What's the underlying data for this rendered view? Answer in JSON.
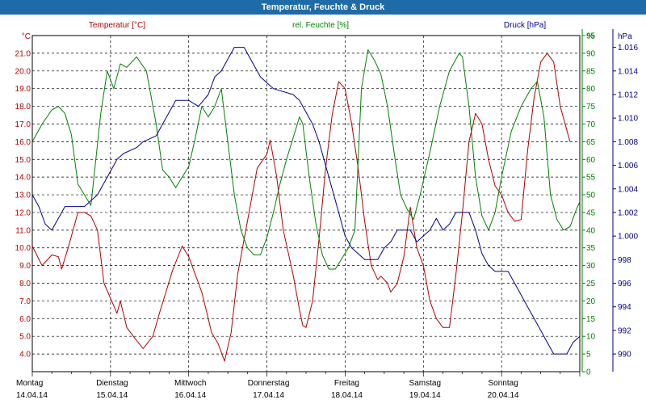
{
  "window": {
    "title": "Temperatur, Feuchte & Druck"
  },
  "colors": {
    "titlebar": "#1f6ba8",
    "temperature": "#b00000",
    "humidity": "#008000",
    "pressure": "#00008b",
    "grid": "#000000"
  },
  "chart_data": {
    "type": "line",
    "title": "Temperatur, Feuchte & Druck",
    "grid": true,
    "x_range": [
      "2014-04-14T00:00",
      "2014-04-21T00:00"
    ],
    "x_ticks": [
      {
        "day": "Montag",
        "date": "14.04.14"
      },
      {
        "day": "Dienstag",
        "date": "15.04.14"
      },
      {
        "day": "Mittwoch",
        "date": "16.04.14"
      },
      {
        "day": "Donnerstag",
        "date": "17.04.14"
      },
      {
        "day": "Freitag",
        "date": "18.04.14"
      },
      {
        "day": "Samstag",
        "date": "19.04.14"
      },
      {
        "day": "Sonntag",
        "date": "20.04.14"
      }
    ],
    "axes": {
      "temperature": {
        "label": "Temperatur [°C]",
        "unit": "°C",
        "ylim": [
          3.0,
          22.0
        ],
        "ticks": [
          "4.0",
          "5.0",
          "6.0",
          "7.0",
          "8.0",
          "9.0",
          "10.0",
          "11.0",
          "12.0",
          "13.0",
          "14.0",
          "15.0",
          "16.0",
          "17.0",
          "18.0",
          "19.0",
          "20.0",
          "21.0"
        ]
      },
      "humidity": {
        "label": "rel. Feuchte [%]",
        "unit": "%",
        "ylim": [
          0,
          95
        ],
        "ticks": [
          "0",
          "5",
          "10",
          "15",
          "20",
          "25",
          "30",
          "35",
          "40",
          "45",
          "50",
          "55",
          "60",
          "65",
          "70",
          "75",
          "80",
          "85",
          "90",
          "95"
        ]
      },
      "pressure": {
        "label": "Druck [hPa]",
        "unit": "hPa",
        "ylim": [
          988.5,
          1017.0
        ],
        "ticks": [
          "990",
          "992",
          "994",
          "996",
          "998",
          "1.000",
          "1.002",
          "1.004",
          "1.006",
          "1.008",
          "1.010",
          "1.012",
          "1.014",
          "1.016"
        ]
      }
    },
    "series": [
      {
        "name": "Temperatur [°C]",
        "axis": "temperature",
        "points": [
          [
            "2014-04-14T00:00",
            10.1
          ],
          [
            "2014-04-14T03:00",
            9.0
          ],
          [
            "2014-04-14T06:00",
            9.6
          ],
          [
            "2014-04-14T08:00",
            9.5
          ],
          [
            "2014-04-14T09:00",
            8.8
          ],
          [
            "2014-04-14T11:00",
            10.0
          ],
          [
            "2014-04-14T14:00",
            12.0
          ],
          [
            "2014-04-14T16:00",
            12.0
          ],
          [
            "2014-04-14T18:00",
            11.8
          ],
          [
            "2014-04-14T20:00",
            11.0
          ],
          [
            "2014-04-14T22:00",
            8.0
          ],
          [
            "2014-04-15T02:00",
            6.3
          ],
          [
            "2014-04-15T03:00",
            7.0
          ],
          [
            "2014-04-15T05:00",
            5.5
          ],
          [
            "2014-04-15T07:00",
            5.0
          ],
          [
            "2014-04-15T10:00",
            4.3
          ],
          [
            "2014-04-15T13:00",
            5.0
          ],
          [
            "2014-04-15T15:00",
            6.3
          ],
          [
            "2014-04-15T17:00",
            7.5
          ],
          [
            "2014-04-15T19:00",
            8.7
          ],
          [
            "2014-04-15T22:00",
            10.1
          ],
          [
            "2014-04-16T00:00",
            9.5
          ],
          [
            "2014-04-16T02:00",
            8.5
          ],
          [
            "2014-04-16T04:00",
            7.5
          ],
          [
            "2014-04-16T06:00",
            6.0
          ],
          [
            "2014-04-16T07:00",
            5.2
          ],
          [
            "2014-04-16T09:00",
            4.6
          ],
          [
            "2014-04-16T11:00",
            3.6
          ],
          [
            "2014-04-16T13:00",
            5.2
          ],
          [
            "2014-04-16T15:00",
            8.5
          ],
          [
            "2014-04-16T18:00",
            11.5
          ],
          [
            "2014-04-16T21:00",
            14.5
          ],
          [
            "2014-04-17T00:00",
            15.3
          ],
          [
            "2014-04-17T01:00",
            16.1
          ],
          [
            "2014-04-17T03:00",
            14.0
          ],
          [
            "2014-04-17T05:00",
            11.0
          ],
          [
            "2014-04-17T08:00",
            8.5
          ],
          [
            "2014-04-17T10:00",
            6.5
          ],
          [
            "2014-04-17T11:00",
            5.6
          ],
          [
            "2014-04-17T12:00",
            5.5
          ],
          [
            "2014-04-17T14:00",
            7.0
          ],
          [
            "2014-04-17T16:00",
            10.5
          ],
          [
            "2014-04-17T18:00",
            14.5
          ],
          [
            "2014-04-17T20:00",
            17.5
          ],
          [
            "2014-04-17T22:00",
            19.4
          ],
          [
            "2014-04-18T00:00",
            19.0
          ],
          [
            "2014-04-18T02:00",
            17.0
          ],
          [
            "2014-04-18T04:00",
            14.5
          ],
          [
            "2014-04-18T06:00",
            11.5
          ],
          [
            "2014-04-18T08:00",
            9.0
          ],
          [
            "2014-04-18T10:00",
            8.2
          ],
          [
            "2014-04-18T11:00",
            8.4
          ],
          [
            "2014-04-18T13:00",
            8.0
          ],
          [
            "2014-04-18T14:00",
            7.5
          ],
          [
            "2014-04-18T16:00",
            8.0
          ],
          [
            "2014-04-18T18:00",
            9.5
          ],
          [
            "2014-04-18T20:00",
            12.3
          ],
          [
            "2014-04-18T22:00",
            10.0
          ],
          [
            "2014-04-19T00:00",
            9.0
          ],
          [
            "2014-04-19T02:00",
            7.0
          ],
          [
            "2014-04-19T04:00",
            6.0
          ],
          [
            "2014-04-19T06:00",
            5.5
          ],
          [
            "2014-04-19T08:00",
            5.5
          ],
          [
            "2014-04-19T10:00",
            8.5
          ],
          [
            "2014-04-19T12:00",
            12.0
          ],
          [
            "2014-04-19T14:00",
            16.0
          ],
          [
            "2014-04-19T16:00",
            17.6
          ],
          [
            "2014-04-19T18:00",
            17.0
          ],
          [
            "2014-04-19T20:00",
            15.0
          ],
          [
            "2014-04-19T22:00",
            13.5
          ],
          [
            "2014-04-20T00:00",
            13.0
          ],
          [
            "2014-04-20T02:00",
            12.0
          ],
          [
            "2014-04-20T04:00",
            11.5
          ],
          [
            "2014-04-20T06:00",
            11.6
          ],
          [
            "2014-04-20T08:00",
            15.5
          ],
          [
            "2014-04-20T10:00",
            18.5
          ],
          [
            "2014-04-20T12:00",
            20.5
          ],
          [
            "2014-04-20T14:00",
            21.0
          ],
          [
            "2014-04-20T16:00",
            20.5
          ],
          [
            "2014-04-20T18:00",
            18.0
          ],
          [
            "2014-04-20T21:00",
            16.0
          ]
        ]
      },
      {
        "name": "rel. Feuchte [%]",
        "axis": "humidity",
        "points": [
          [
            "2014-04-14T00:00",
            65
          ],
          [
            "2014-04-14T03:00",
            70
          ],
          [
            "2014-04-14T06:00",
            74
          ],
          [
            "2014-04-14T08:00",
            75
          ],
          [
            "2014-04-14T10:00",
            73
          ],
          [
            "2014-04-14T12:00",
            67
          ],
          [
            "2014-04-14T14:00",
            53
          ],
          [
            "2014-04-14T16:00",
            50
          ],
          [
            "2014-04-14T18:00",
            47
          ],
          [
            "2014-04-14T21:00",
            73
          ],
          [
            "2014-04-14T23:00",
            85
          ],
          [
            "2014-04-15T01:00",
            80
          ],
          [
            "2014-04-15T03:00",
            87
          ],
          [
            "2014-04-15T05:00",
            86
          ],
          [
            "2014-04-15T08:00",
            89
          ],
          [
            "2014-04-15T11:00",
            85
          ],
          [
            "2014-04-15T14:00",
            70
          ],
          [
            "2014-04-15T16:00",
            57
          ],
          [
            "2014-04-15T18:00",
            55
          ],
          [
            "2014-04-15T20:00",
            52
          ],
          [
            "2014-04-15T22:00",
            55
          ],
          [
            "2014-04-16T00:00",
            58
          ],
          [
            "2014-04-16T02:00",
            66
          ],
          [
            "2014-04-16T04:00",
            75
          ],
          [
            "2014-04-16T06:00",
            72
          ],
          [
            "2014-04-16T08:00",
            75
          ],
          [
            "2014-04-16T10:00",
            80
          ],
          [
            "2014-04-16T12:00",
            65
          ],
          [
            "2014-04-16T14:00",
            50
          ],
          [
            "2014-04-16T16:00",
            40
          ],
          [
            "2014-04-16T18:00",
            35
          ],
          [
            "2014-04-16T20:00",
            33
          ],
          [
            "2014-04-16T22:00",
            33
          ],
          [
            "2014-04-17T00:00",
            38
          ],
          [
            "2014-04-17T02:00",
            45
          ],
          [
            "2014-04-17T04:00",
            53
          ],
          [
            "2014-04-17T06:00",
            60
          ],
          [
            "2014-04-17T08:00",
            66
          ],
          [
            "2014-04-17T10:00",
            72
          ],
          [
            "2014-04-17T11:00",
            70
          ],
          [
            "2014-04-17T13:00",
            55
          ],
          [
            "2014-04-17T15:00",
            42
          ],
          [
            "2014-04-17T17:00",
            33
          ],
          [
            "2014-04-17T19:00",
            29
          ],
          [
            "2014-04-17T21:00",
            29
          ],
          [
            "2014-04-17T23:00",
            32
          ],
          [
            "2014-04-18T01:00",
            35
          ],
          [
            "2014-04-18T03:00",
            40
          ],
          [
            "2014-04-18T04:00",
            60
          ],
          [
            "2014-04-18T05:00",
            80
          ],
          [
            "2014-04-18T07:00",
            91
          ],
          [
            "2014-04-18T09:00",
            88
          ],
          [
            "2014-04-18T11:00",
            84
          ],
          [
            "2014-04-18T13:00",
            75
          ],
          [
            "2014-04-18T15:00",
            62
          ],
          [
            "2014-04-18T17:00",
            50
          ],
          [
            "2014-04-18T19:00",
            46
          ],
          [
            "2014-04-18T21:00",
            43
          ],
          [
            "2014-04-18T23:00",
            50
          ],
          [
            "2014-04-19T02:00",
            62
          ],
          [
            "2014-04-19T05:00",
            75
          ],
          [
            "2014-04-19T08:00",
            85
          ],
          [
            "2014-04-19T11:00",
            90
          ],
          [
            "2014-04-19T12:00",
            89
          ],
          [
            "2014-04-19T14:00",
            75
          ],
          [
            "2014-04-19T16:00",
            55
          ],
          [
            "2014-04-19T18:00",
            44
          ],
          [
            "2014-04-19T20:00",
            40
          ],
          [
            "2014-04-19T22:00",
            45
          ],
          [
            "2014-04-20T00:00",
            55
          ],
          [
            "2014-04-20T03:00",
            68
          ],
          [
            "2014-04-20T06:00",
            75
          ],
          [
            "2014-04-20T09:00",
            80
          ],
          [
            "2014-04-20T11:00",
            82
          ],
          [
            "2014-04-20T13:00",
            72
          ],
          [
            "2014-04-20T15:00",
            50
          ],
          [
            "2014-04-20T17:00",
            43
          ],
          [
            "2014-04-20T19:00",
            40
          ],
          [
            "2014-04-20T21:00",
            41
          ],
          [
            "2014-04-20T23:00",
            46
          ],
          [
            "2014-04-21T00:00",
            48
          ]
        ]
      },
      {
        "name": "Druck [hPa]",
        "axis": "pressure",
        "points": [
          [
            "2014-04-14T00:00",
            1003.5
          ],
          [
            "2014-04-14T02:00",
            1002.5
          ],
          [
            "2014-04-14T04:00",
            1001.0
          ],
          [
            "2014-04-14T06:00",
            1000.5
          ],
          [
            "2014-04-14T08:00",
            1001.5
          ],
          [
            "2014-04-14T10:00",
            1002.5
          ],
          [
            "2014-04-14T16:00",
            1002.5
          ],
          [
            "2014-04-14T18:00",
            1003.0
          ],
          [
            "2014-04-14T20:00",
            1003.5
          ],
          [
            "2014-04-14T22:00",
            1004.5
          ],
          [
            "2014-04-15T00:00",
            1005.5
          ],
          [
            "2014-04-15T02:00",
            1006.5
          ],
          [
            "2014-04-15T04:00",
            1007.0
          ],
          [
            "2014-04-15T08:00",
            1007.5
          ],
          [
            "2014-04-15T10:00",
            1008.0
          ],
          [
            "2014-04-15T14:00",
            1008.5
          ],
          [
            "2014-04-15T16:00",
            1009.5
          ],
          [
            "2014-04-15T18:00",
            1010.5
          ],
          [
            "2014-04-15T20:00",
            1011.5
          ],
          [
            "2014-04-16T00:00",
            1011.5
          ],
          [
            "2014-04-16T03:00",
            1011.0
          ],
          [
            "2014-04-16T06:00",
            1012.0
          ],
          [
            "2014-04-16T08:00",
            1013.5
          ],
          [
            "2014-04-16T10:00",
            1014.0
          ],
          [
            "2014-04-16T12:00",
            1015.0
          ],
          [
            "2014-04-16T14:00",
            1016.0
          ],
          [
            "2014-04-16T17:00",
            1016.0
          ],
          [
            "2014-04-16T20:00",
            1014.5
          ],
          [
            "2014-04-16T22:00",
            1013.5
          ],
          [
            "2014-04-17T02:00",
            1012.5
          ],
          [
            "2014-04-17T08:00",
            1012.0
          ],
          [
            "2014-04-17T10:00",
            1011.5
          ],
          [
            "2014-04-17T12:00",
            1010.5
          ],
          [
            "2014-04-17T14:00",
            1009.5
          ],
          [
            "2014-04-17T16:00",
            1008.0
          ],
          [
            "2014-04-17T18:00",
            1006.0
          ],
          [
            "2014-04-17T20:00",
            1004.0
          ],
          [
            "2014-04-17T22:00",
            1002.0
          ],
          [
            "2014-04-18T00:00",
            1000.0
          ],
          [
            "2014-04-18T02:00",
            999.0
          ],
          [
            "2014-04-18T04:00",
            998.5
          ],
          [
            "2014-04-18T06:00",
            998.0
          ],
          [
            "2014-04-18T10:00",
            998.0
          ],
          [
            "2014-04-18T12:00",
            999.0
          ],
          [
            "2014-04-18T14:00",
            999.5
          ],
          [
            "2014-04-18T16:00",
            1000.5
          ],
          [
            "2014-04-18T20:00",
            1000.5
          ],
          [
            "2014-04-18T22:00",
            999.5
          ],
          [
            "2014-04-19T02:00",
            1000.5
          ],
          [
            "2014-04-19T04:00",
            1001.5
          ],
          [
            "2014-04-19T06:00",
            1000.5
          ],
          [
            "2014-04-19T08:00",
            1001.0
          ],
          [
            "2014-04-19T10:00",
            1002.0
          ],
          [
            "2014-04-19T14:00",
            1002.0
          ],
          [
            "2014-04-19T16:00",
            1000.5
          ],
          [
            "2014-04-19T18:00",
            998.5
          ],
          [
            "2014-04-19T20:00",
            997.5
          ],
          [
            "2014-04-19T22:00",
            997.0
          ],
          [
            "2014-04-20T02:00",
            997.0
          ],
          [
            "2014-04-20T04:00",
            996.0
          ],
          [
            "2014-04-20T06:00",
            995.0
          ],
          [
            "2014-04-20T08:00",
            994.0
          ],
          [
            "2014-04-20T10:00",
            993.0
          ],
          [
            "2014-04-20T12:00",
            992.0
          ],
          [
            "2014-04-20T14:00",
            991.0
          ],
          [
            "2014-04-20T16:00",
            990.0
          ],
          [
            "2014-04-20T20:00",
            990.0
          ],
          [
            "2014-04-20T22:00",
            991.0
          ],
          [
            "2014-04-21T00:00",
            991.5
          ]
        ]
      }
    ]
  }
}
